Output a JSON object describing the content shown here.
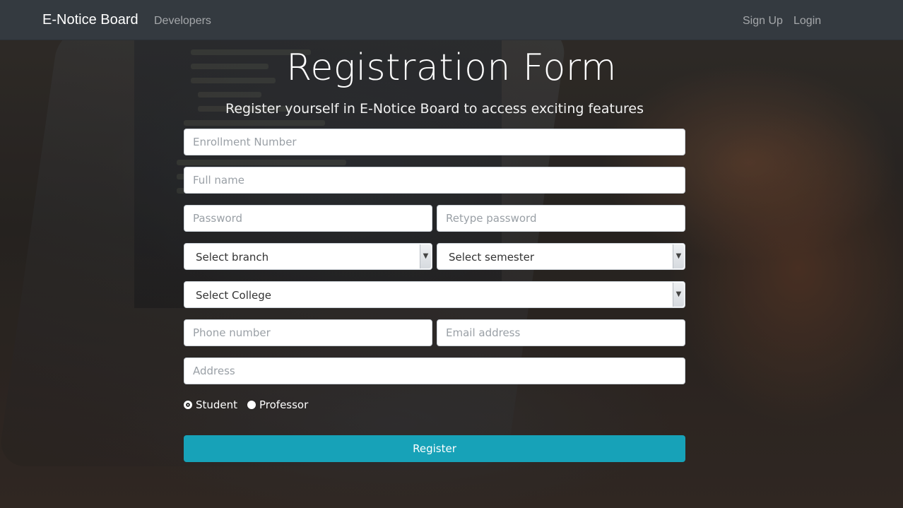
{
  "navbar": {
    "brand": "E-Notice Board",
    "links": [
      "Developers"
    ],
    "right_links": [
      "Sign Up",
      "Login"
    ]
  },
  "header": {
    "title": "Registration Form",
    "subtitle": "Register yourself in E-Notice Board to access exciting features"
  },
  "form": {
    "enrollment_placeholder": "Enrollment Number",
    "fullname_placeholder": "Full name",
    "password_placeholder": "Password",
    "retype_password_placeholder": "Retype password",
    "branch_select": "Select branch",
    "semester_select": "Select semester",
    "college_select": "Select College",
    "phone_placeholder": "Phone number",
    "email_placeholder": "Email address",
    "address_placeholder": "Address",
    "role_options": [
      "Student",
      "Professor"
    ],
    "selected_role": "Student",
    "submit_label": "Register"
  },
  "colors": {
    "navbar_bg": "#343a40",
    "register_button": "#17a2b8"
  }
}
